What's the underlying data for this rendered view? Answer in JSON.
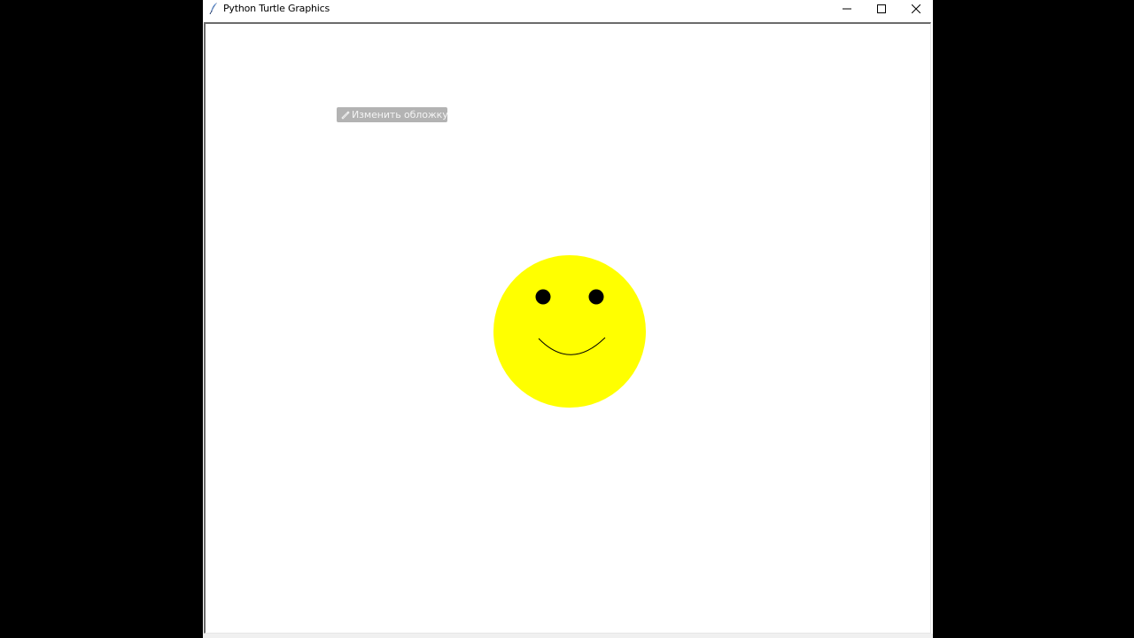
{
  "window": {
    "title": "Python Turtle Graphics",
    "icon": "feather-icon",
    "controls": {
      "minimize": "minimize-icon",
      "maximize": "maximize-icon",
      "close": "close-icon"
    }
  },
  "overlay": {
    "label": "Изменить обложку",
    "icon": "pencil-icon"
  },
  "drawing": {
    "face_color": "#ffff00",
    "eye_color": "#000000",
    "mouth_color": "#000000"
  }
}
